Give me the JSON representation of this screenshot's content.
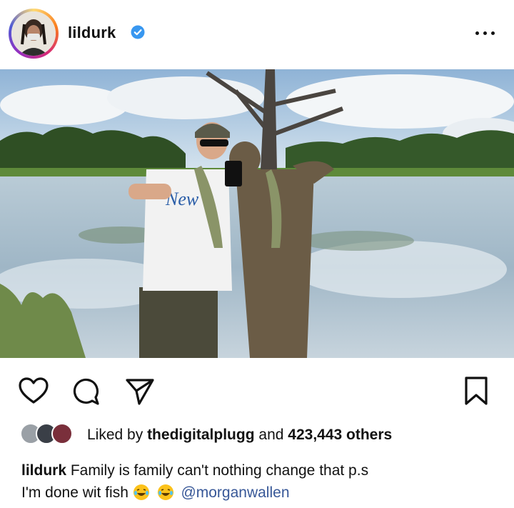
{
  "post": {
    "username": "lildurk",
    "verified": true,
    "menu_icon": "more-horizontal-icon"
  },
  "photo": {
    "shirt_text": "New"
  },
  "actions": {
    "like_icon": "heart-icon",
    "comment_icon": "comment-icon",
    "share_icon": "send-icon",
    "save_icon": "bookmark-icon"
  },
  "likes": {
    "prefix": "Liked by",
    "user": "thedigitalplugg",
    "middle": "and",
    "count_text": "423,443 others"
  },
  "caption": {
    "username": "lildurk",
    "text_line1": "Family is family can't nothing change that p.s",
    "text_line2": "I'm done wit fish",
    "emojis": [
      "😂",
      "😂"
    ],
    "mention": "@morganwallen"
  },
  "colors": {
    "verified_blue": "#3897f0",
    "mention_blue": "#385898",
    "text": "#111111"
  }
}
